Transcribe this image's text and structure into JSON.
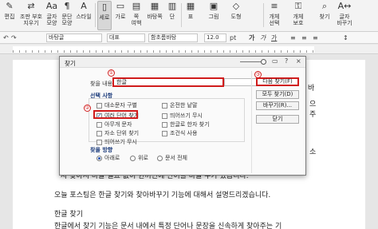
{
  "ribbon": {
    "buttons": [
      {
        "icon": "✎",
        "label": "편집"
      },
      {
        "icon": "⇄",
        "label": "조판 부호\n지우기"
      },
      {
        "icon": "Aa",
        "label": "글자\n모양"
      },
      {
        "icon": "¶",
        "label": "문단\n모양"
      },
      {
        "icon": "A",
        "label": "스타일"
      },
      {
        "icon": "▯",
        "label": "세로"
      },
      {
        "icon": "▭",
        "label": "가로"
      },
      {
        "icon": "▤",
        "label": "쪽\n여백"
      },
      {
        "icon": "▦",
        "label": "바탕쪽"
      },
      {
        "icon": "▥",
        "label": "단"
      },
      {
        "icon": "▦",
        "label": "표"
      },
      {
        "icon": "▣",
        "label": "그림"
      },
      {
        "icon": "◇",
        "label": "도형"
      },
      {
        "icon": "≡",
        "label": "개체\n선택"
      },
      {
        "icon": "⚿",
        "label": "개체\n보호"
      },
      {
        "icon": "⌕",
        "label": "찾기"
      },
      {
        "icon": "A↔",
        "label": "글자\n바꾸기"
      }
    ]
  },
  "format_bar": {
    "style": "바탕글",
    "lang": "대표",
    "font": "함초롬바탕",
    "size": "12.0",
    "unit": "pt"
  },
  "document": {
    "lines": [
      "사 찾아서 바꿀 필요 없이 한꺼번에 단어를 바꿀 수가 있습니다.",
      "오늘 포스팅은 한글 찾기와 찾아바꾸기 기능에 대해서 설명드리겠습니다.",
      "한글 찾기",
      "한글에서 찾기 기능은 문서 내에서 특정 단어나 문장을 신속하게 찾아주는 기"
    ],
    "side_chars": [
      "바",
      "으",
      "주",
      "소"
    ]
  },
  "dialog": {
    "title": "찾기",
    "help_icon": "?",
    "close_icon": "×",
    "find_label": "찾을 내용",
    "find_value": "한글",
    "options_title": "선택 사항",
    "options_left": [
      {
        "label": "대소문자 구별",
        "checked": false
      },
      {
        "label": "여러 단어 찾기",
        "checked": true
      },
      {
        "label": "아무개 문자",
        "checked": false
      },
      {
        "label": "자소 단위 찾기",
        "checked": false
      },
      {
        "label": "띄어쓰기 무시",
        "checked": false
      }
    ],
    "options_right": [
      {
        "label": "온전한 낱말",
        "checked": false
      },
      {
        "label": "띄어쓰기 무시",
        "checked": false
      },
      {
        "label": "한글로 한자 찾기",
        "checked": false
      },
      {
        "label": "조건식 사용",
        "checked": false
      }
    ],
    "direction_title": "찾을 방향",
    "directions": [
      {
        "label": "아래로",
        "selected": true
      },
      {
        "label": "위로",
        "selected": false
      },
      {
        "label": "문서 전체",
        "selected": false
      }
    ],
    "buttons": [
      "다음 찾기(F)",
      "모두 찾기(D)",
      "바꾸기(R)...",
      "닫기"
    ],
    "markers": [
      "①",
      "②",
      "③"
    ]
  }
}
